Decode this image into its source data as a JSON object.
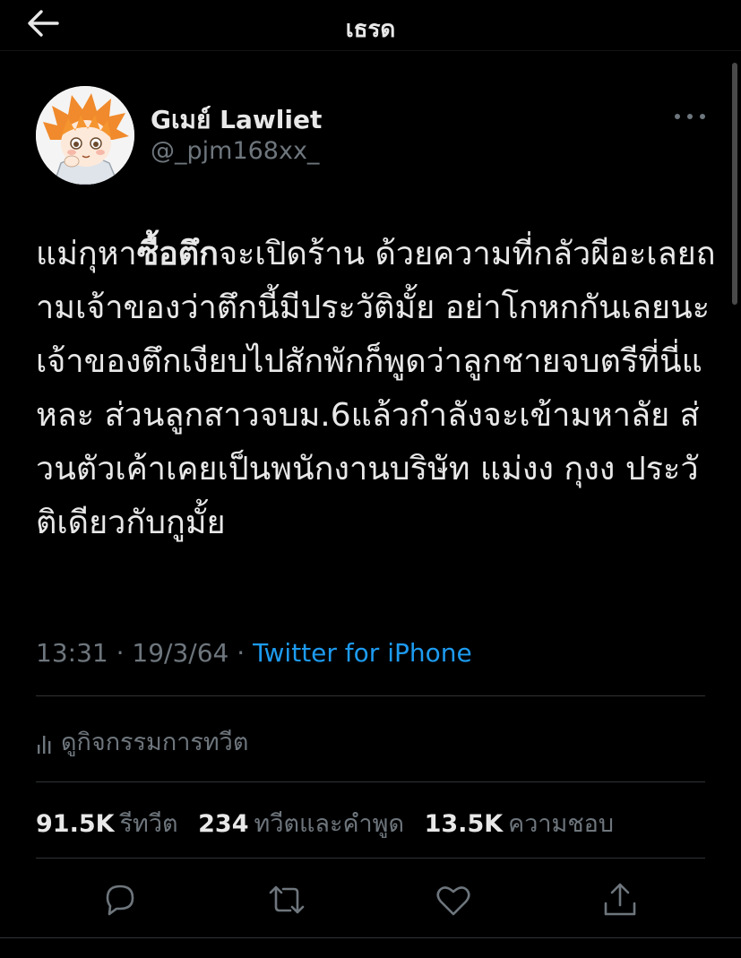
{
  "header": {
    "title": "เธรด"
  },
  "author": {
    "display_name": "Gเมย์ Lawliet",
    "handle": "@_pjm168xx_"
  },
  "tweet": {
    "text_before": "แม่กุหา",
    "text_bold": "ซื้อตึก",
    "text_after": "จะเปิดร้าน ด้วยความที่กลัวผีอะเลยถามเจ้าของว่าตึกนี้มีประวัติมั้ย อย่าโกหกกันเลยนะ เจ้าของตึกเงียบไปสักพักก็พูดว่าลูกชายจบตรีที่นี่แหละ ส่วนลูกสาวจบม.6แล้วกำลังจะเข้ามหาลัย ส่วนตัวเค้าเคยเป็นพนักงานบริษัท แม่งง กุงง ประวัติเดียวกับกูมั้ย"
  },
  "meta": {
    "time": "13:31",
    "date": "19/3/64",
    "separator": " · ",
    "source": "Twitter for iPhone"
  },
  "activity": {
    "label": "ดูกิจกรรมการทวีต"
  },
  "stats": {
    "retweets_count": "91.5K",
    "retweets_label": "รีทวีต",
    "quotes_count": "234",
    "quotes_label": "ทวีตและคำพูด",
    "likes_count": "13.5K",
    "likes_label": "ความชอบ"
  },
  "icons": {
    "back": "arrow-left-icon",
    "more": "more-horizontal-icon",
    "analytics": "bar-chart-icon",
    "reply": "reply-icon",
    "retweet": "retweet-icon",
    "like": "heart-icon",
    "share": "share-icon"
  },
  "colors": {
    "background": "#000000",
    "text_primary": "#e8e8e8",
    "text_secondary": "#6e767d",
    "link": "#1d9bf0",
    "divider": "#2f3336",
    "avatar_hair": "#f08a2c"
  }
}
